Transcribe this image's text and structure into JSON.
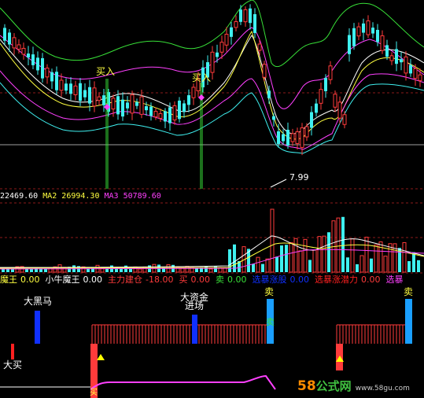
{
  "colors": {
    "background": "#000000",
    "grid_red": "#8b1a1a",
    "up_red": "#ff3b3b",
    "down_cyan": "#3ff0f0",
    "ma_white": "#ffffff",
    "ma_yellow": "#ffff40",
    "ma_magenta": "#ff40ff",
    "ma_green": "#38e038",
    "signal_blue": "#1030ff",
    "signal_red": "#ff2020",
    "watermark_orange": "#ff8c00",
    "watermark_green": "#40c040"
  },
  "main_panel": {
    "buy_labels": [
      "买入",
      "买入"
    ],
    "low_price_label": "7.99"
  },
  "volume_panel": {
    "header": {
      "ma1_value": "22469.60",
      "ma2_label": "MA2",
      "ma2_value": "26994.30",
      "ma3_label": "MA3",
      "ma3_value": "50789.60"
    }
  },
  "indicator_panel": {
    "header": [
      {
        "label": "魔王",
        "value": "0.00",
        "label_color": "#ffff40",
        "value_color": "#ffff40"
      },
      {
        "label": "小牛魔王",
        "value": "0.00",
        "label_color": "#ffffff",
        "value_color": "#ffffff"
      },
      {
        "label": "主力建仓",
        "value": "-18.00",
        "label_color": "#ff3b3b",
        "value_color": "#ff3b3b"
      },
      {
        "label": "买",
        "value": "0.00",
        "label_color": "#ff3b3b",
        "value_color": "#ff3b3b"
      },
      {
        "label": "卖",
        "value": "0.00",
        "label_color": "#38e038",
        "value_color": "#38e038"
      },
      {
        "label": "选暴涨股",
        "value": "0.00",
        "label_color": "#1030ff",
        "value_color": "#1030ff"
      },
      {
        "label": "选暴涨潜力",
        "value": "0.00",
        "label_color": "#ff2020",
        "value_color": "#ff3b3b"
      },
      {
        "label": "选暴",
        "value": "",
        "label_color": "#ff40ff",
        "value_color": "#ff40ff"
      }
    ],
    "signal_labels": {
      "big_black_horse": "大黑马",
      "big_capital_line1": "大资金",
      "big_capital_line2": "进场",
      "sell_1": "卖",
      "sell_2": "卖",
      "big_buy": "大买",
      "sell_small": "卖",
      "buy_small": "买"
    }
  },
  "watermark": {
    "brand_number": "58",
    "brand_text": "公式网",
    "url": "www.58gu.com"
  }
}
